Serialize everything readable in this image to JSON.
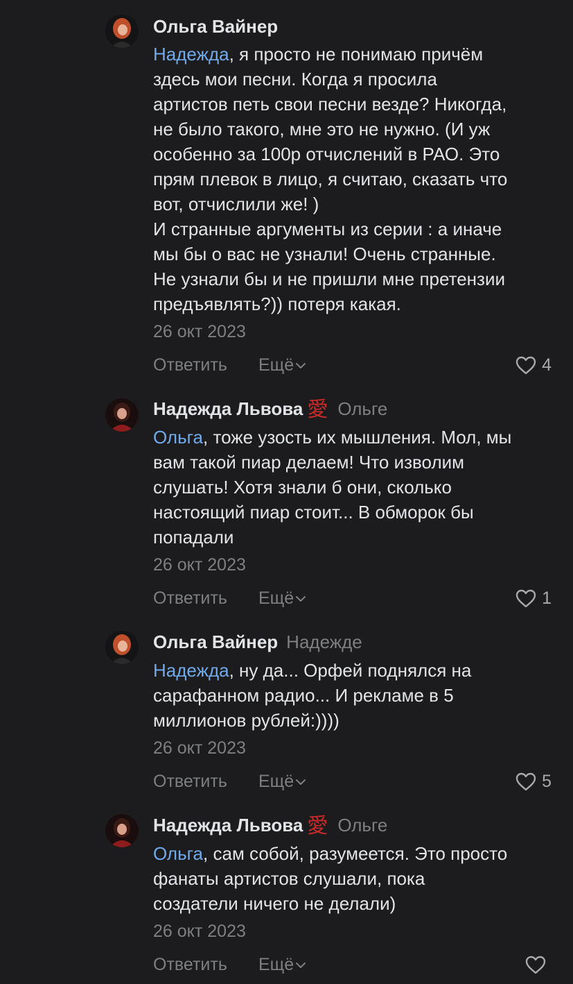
{
  "comments": [
    {
      "author": "Ольга Вайнер",
      "reply_to": "",
      "badge": "",
      "mention": "Надежда",
      "text": ", я просто не понимаю причём\nздесь мои песни. Когда я просила\nартистов петь свои песни везде? Никогда,\nне было такого, мне это не нужно. (И уж\nособенно за 100р отчислений в РАО. Это\nпрям плевок в лицо, я считаю, сказать что\nвот, отчислили же! )\nИ странные аргументы из серии : а иначе\nмы бы о вас не узнали! Очень странные.\nНе узнали бы и не пришли мне претензии\nпредъявлять?)) потеря какая.",
      "date": "26 окт 2023",
      "reply_label": "Ответить",
      "more_label": "Ещё",
      "likes": "4"
    },
    {
      "author": "Надежда Львова",
      "badge": "愛",
      "reply_to": "Ольге",
      "mention": "Ольга",
      "text": ", тоже узость их мышления. Мол, мы\nвам такой пиар делаем! Что изволим\nслушать! Хотя знали б они, сколько\nнастоящий пиар стоит... В обморок бы\nпопадали",
      "date": "26 окт 2023",
      "reply_label": "Ответить",
      "more_label": "Ещё",
      "likes": "1"
    },
    {
      "author": "Ольга Вайнер",
      "badge": "",
      "reply_to": "Надежде",
      "mention": "Надежда",
      "text": ", ну да... Орфей поднялся на\nсарафанном радио... И рекламе в 5\nмиллионов рублей:))))",
      "date": "26 окт 2023",
      "reply_label": "Ответить",
      "more_label": "Ещё",
      "likes": "5"
    },
    {
      "author": "Надежда Львова",
      "badge": "愛",
      "reply_to": "Ольге",
      "mention": "Ольга",
      "text": ", сам собой, разумеется. Это просто\nфанаты артистов слушали, пока\nсоздатели ничего не делали)",
      "date": "26 окт 2023",
      "reply_label": "Ответить",
      "more_label": "Ещё",
      "likes": ""
    }
  ],
  "icons": {
    "like": "heart-outline-icon",
    "more": "chevron-down-icon"
  },
  "colors": {
    "background": "#1c1c1e",
    "text": "#e1e3e6",
    "secondary": "#7d7f83",
    "mention": "#71aaeb",
    "badge": "#c82a2a"
  }
}
